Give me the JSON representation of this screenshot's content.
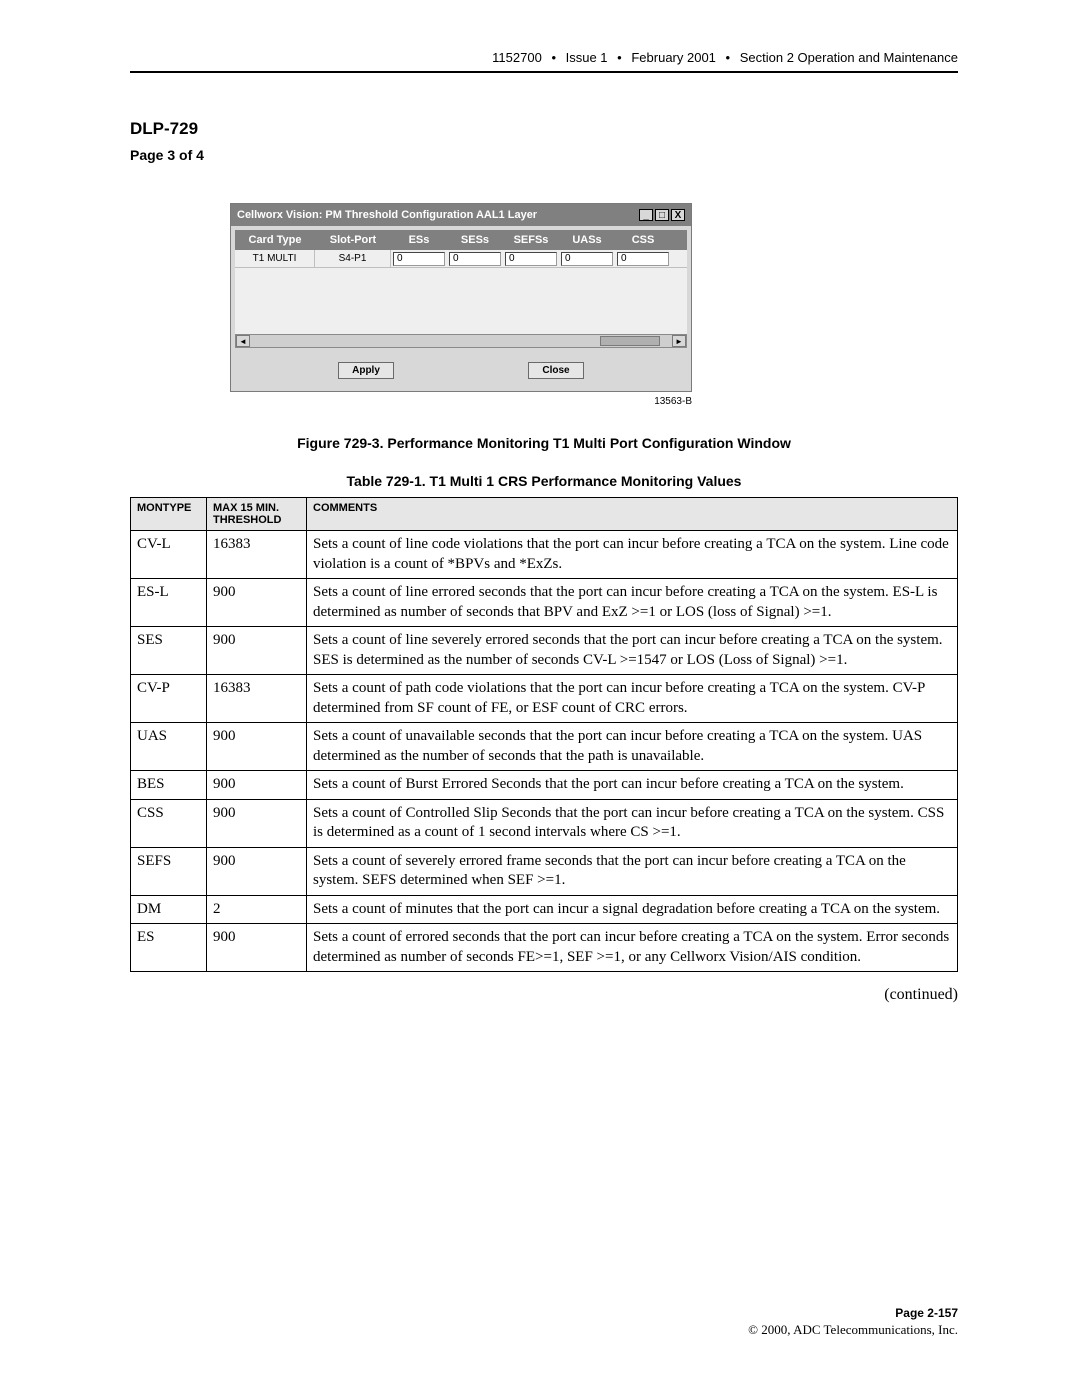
{
  "running_head": {
    "doc_no": "1152700",
    "issue": "Issue 1",
    "date": "February 2001",
    "section": "Section 2 Operation and Maintenance"
  },
  "dlp": "DLP-729",
  "page_xy": "Page 3 of 4",
  "window": {
    "title": "Cellworx Vision:  PM Threshold Configuration AAL1 Layer",
    "ctrl_min": "_",
    "ctrl_max": "□",
    "ctrl_close": "X",
    "headers": [
      "Card Type",
      "Slot-Port",
      "ESs",
      "SESs",
      "SEFSs",
      "UASs",
      "CSS"
    ],
    "row": {
      "card_type": "T1 MULTI",
      "slot_port": "S4-P1",
      "vals": [
        "0",
        "0",
        "0",
        "0",
        "0"
      ]
    },
    "apply": "Apply",
    "close": "Close",
    "fig_id": "13563-B"
  },
  "figure_caption": "Figure 729-3. Performance Monitoring T1 Multi Port Configuration Window",
  "table_caption": "Table 729-1. T1 Multi 1 CRS Performance Monitoring Values",
  "table": {
    "head": {
      "montype": "MONTYPE",
      "threshold": "MAX 15 MIN. THRESHOLD",
      "comments": "COMMENTS"
    },
    "rows": [
      {
        "montype": "CV-L",
        "threshold": "16383",
        "comments": "Sets a count of line code violations that the port can incur before creating a TCA on the system. Line code violation is a count of *BPVs and *ExZs."
      },
      {
        "montype": "ES-L",
        "threshold": "900",
        "comments": "Sets a count of line errored seconds that the port can incur before creating a TCA on the system. ES-L is determined as number of seconds that BPV and ExZ >=1 or LOS (loss of Signal) >=1."
      },
      {
        "montype": "SES",
        "threshold": "900",
        "comments": "Sets a count of line severely errored seconds that the port can incur before creating a TCA on the system. SES is determined as the number of seconds CV-L >=1547  or LOS (Loss of Signal) >=1."
      },
      {
        "montype": "CV-P",
        "threshold": "16383",
        "comments": "Sets a count of path code violations that the port can incur before creating a TCA on the system. CV-P determined from SF count of FE, or ESF count of CRC errors."
      },
      {
        "montype": "UAS",
        "threshold": "900",
        "comments": "Sets a count of unavailable seconds that the port can incur before creating a TCA on the system. UAS determined as the number of seconds that the path is unavailable."
      },
      {
        "montype": "BES",
        "threshold": "900",
        "comments": "Sets a count of Burst Errored Seconds that the port can incur before creating a TCA on the system."
      },
      {
        "montype": "CSS",
        "threshold": "900",
        "comments": "Sets a count of  Controlled Slip Seconds  that the port can incur before creating a TCA on the system. CSS is determined as a count of 1 second intervals where CS >=1."
      },
      {
        "montype": "SEFS",
        "threshold": "900",
        "comments": "Sets a count of severely errored frame seconds that the port can incur before creating a TCA on the system. SEFS determined when SEF >=1."
      },
      {
        "montype": "DM",
        "threshold": "2",
        "comments": "Sets a count of minutes that the port can incur a signal degradation before creating a TCA on the system."
      },
      {
        "montype": "ES",
        "threshold": "900",
        "comments": "Sets a count of errored seconds that the port can incur before creating a TCA on the system. Error seconds determined as number of seconds FE>=1, SEF >=1, or any Cellworx Vision/AIS condition."
      }
    ]
  },
  "continued": "(continued)",
  "footer": {
    "page": "Page 2-157",
    "copyright": "© 2000, ADC Telecommunications, Inc."
  }
}
